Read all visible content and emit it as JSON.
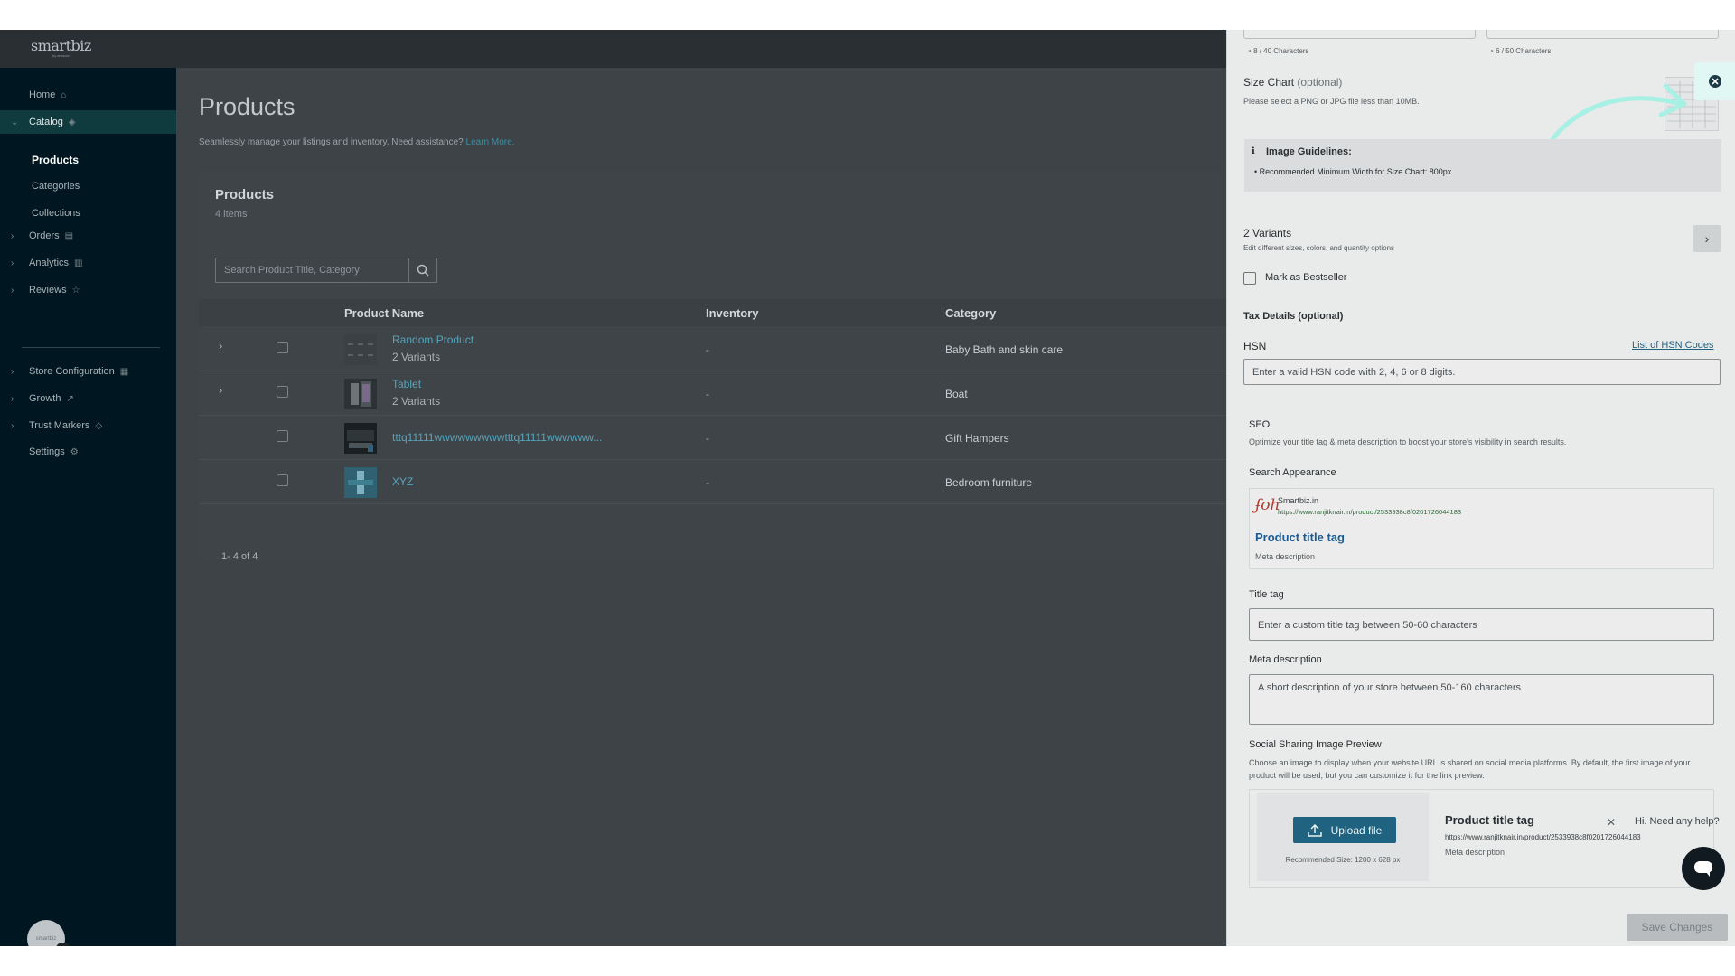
{
  "app": {
    "logo": "smartbiz",
    "logo_sub": "by amazon"
  },
  "sidebar": {
    "items": [
      {
        "label": "Home",
        "icon": "home-icon",
        "glyph": "⌂"
      },
      {
        "label": "Catalog",
        "icon": "tag-icon",
        "glyph": "◈"
      },
      {
        "label": "Orders",
        "icon": "clipboard-icon",
        "glyph": "▤"
      },
      {
        "label": "Analytics",
        "icon": "bar-chart-icon",
        "glyph": "▥"
      },
      {
        "label": "Reviews",
        "icon": "star-icon",
        "glyph": "☆"
      },
      {
        "label": "Store Configuration",
        "icon": "store-icon",
        "glyph": "▦"
      },
      {
        "label": "Growth",
        "icon": "trend-icon",
        "glyph": "↗"
      },
      {
        "label": "Trust Markers",
        "icon": "shield-icon",
        "glyph": "◇"
      },
      {
        "label": "Settings",
        "icon": "gear-icon",
        "glyph": "⚙"
      }
    ],
    "catalog_sub": [
      "Products",
      "Categories",
      "Collections"
    ],
    "avatar_text": "smartbiz",
    "avatar_badge": "15"
  },
  "main": {
    "title": "Products",
    "desc": "Seamlessly manage your listings and inventory. Need assistance?",
    "learn_more": "Learn More.",
    "card_title": "Products",
    "card_count": "4 items",
    "search_placeholder": "Search Product Title, Category",
    "columns": [
      "Product Name",
      "Inventory",
      "Category"
    ],
    "rows": [
      {
        "name": "Random Product",
        "variants": "2 Variants",
        "inventory": "-",
        "category": "Baby Bath and skin care"
      },
      {
        "name": "Tablet",
        "variants": "2 Variants",
        "inventory": "-",
        "category": "Boat"
      },
      {
        "name": "tttq11111wwwwwwwwwtttq11111wwwwww...",
        "variants": "",
        "inventory": "-",
        "category": "Gift Hampers"
      },
      {
        "name": "XYZ",
        "variants": "",
        "inventory": "-",
        "category": "Bedroom furniture"
      }
    ],
    "pager": "1- 4 of 4"
  },
  "panel": {
    "char_count_1": "8 / 40 Characters",
    "char_count_2": "6 / 50 Characters",
    "size_chart_label": "Size Chart",
    "size_chart_optional": "(optional)",
    "size_chart_help": "Please select a PNG or JPG file less than 10MB.",
    "guidelines_title": "Image Guidelines:",
    "guidelines_item": "Recommended Minimum Width for Size Chart: 800px",
    "variants_title": "2 Variants",
    "variants_desc": "Edit different sizes, colors, and quantity options",
    "bestseller_label": "Mark as Bestseller",
    "tax_title": "Tax Details (optional)",
    "hsn_label": "HSN",
    "hsn_link": "List of HSN Codes",
    "hsn_placeholder": "Enter a valid HSN code with 2, 4, 6 or 8 digits.",
    "seo_title": "SEO",
    "seo_desc": "Optimize your title tag & meta description to boost your store's visibility in search results.",
    "search_appearance": "Search Appearance",
    "serp_site": "Smartbiz.in",
    "serp_url": "https://www.ranjitknair.in/product/2533938c8f0201726044183",
    "serp_title": "Product title tag",
    "serp_meta": "Meta description",
    "title_tag_label": "Title tag",
    "title_tag_placeholder": "Enter a custom title tag between 50-60 characters",
    "meta_label": "Meta description",
    "meta_placeholder": "A short description of your store between 50-160 characters",
    "social_title": "Social Sharing Image Preview",
    "social_desc": "Choose an image to display when your website URL is shared on social media platforms. By default, the first image of your product will be used, but you can customize it for the link preview.",
    "upload_label": "Upload file",
    "upload_hint": "Recommended Size: 1200 x 628 px",
    "social_card_title": "Product title tag",
    "social_card_url": "https://www.ranjitknair.in/product/2533938c8f0201726044183",
    "social_card_meta": "Meta description",
    "chat_tip": "Hi. Need any help?",
    "save_label": "Save Changes"
  },
  "colors": {
    "accent": "#1f6380",
    "sidebar": "#001620",
    "highlight": "#a6f0e4"
  }
}
